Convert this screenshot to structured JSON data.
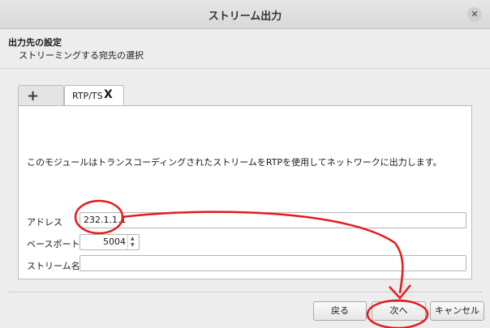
{
  "window": {
    "title": "ストリーム出力",
    "close_icon": "close-icon"
  },
  "header": {
    "title": "出力先の設定",
    "subtitle": "ストリーミングする宛先の選択"
  },
  "tabs": [
    {
      "label": "+",
      "icon": "plus-icon"
    },
    {
      "label": "RTP/TS",
      "close_glyph": "X",
      "icon": "close-tab-icon"
    }
  ],
  "panel": {
    "description": "このモジュールはトランスコーディングされたストリームをRTPを使用してネットワークに出力します。",
    "address_label": "アドレス",
    "address_value": "232.1.1.1",
    "baseport_label": "ベースポート",
    "baseport_value": "5004",
    "stream_name_label": "ストリーム名",
    "stream_name_value": ""
  },
  "buttons": {
    "back": "戻る",
    "next": "次へ",
    "cancel": "キャンセル"
  },
  "colors": {
    "annotation_red": "#e31b1b",
    "panel_bg": "#ffffff",
    "window_bg": "#ededed"
  }
}
